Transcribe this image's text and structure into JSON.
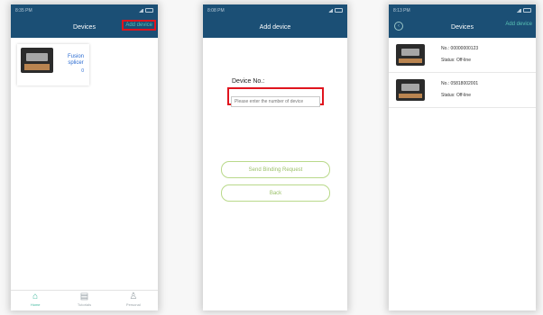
{
  "screen1": {
    "status_time": "8:35 PM",
    "title": "Devices",
    "add_device": "Add device",
    "card": {
      "name": "Fusion splicer",
      "count": "0"
    },
    "tabs": [
      {
        "label": "Home",
        "icon": "home-icon"
      },
      {
        "label": "Tutorials",
        "icon": "tutorials-icon"
      },
      {
        "label": "Personal",
        "icon": "person-icon"
      }
    ]
  },
  "screen2": {
    "status_time": "8:08 PM",
    "title": "Add device",
    "device_label": "Device No.:",
    "input_placeholder": "Please enter the number of device",
    "send_button": "Send Binding Request",
    "back_button": "Back"
  },
  "screen3": {
    "status_time": "8:13 PM",
    "title": "Devices",
    "add_device": "Add device",
    "devices": [
      {
        "no": "No.: 00000000123",
        "status": "Status: Off-line"
      },
      {
        "no": "No.: 05818002001",
        "status": "Status: Off-line"
      }
    ]
  }
}
